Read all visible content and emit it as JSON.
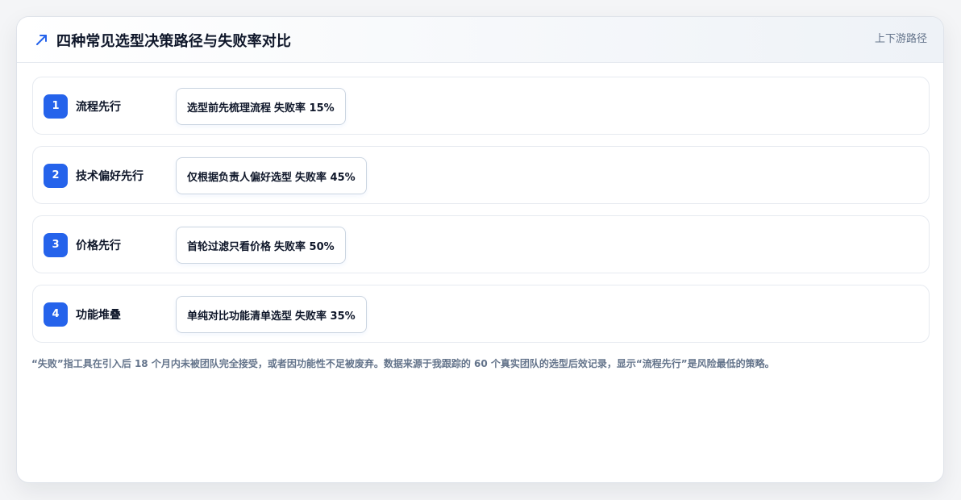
{
  "header": {
    "title": "四种常见选型决策路径与失败率对比",
    "tag": "上下游路径",
    "icon": "trend-arrow-icon"
  },
  "colors": {
    "accent": "#2563eb",
    "text": "#0f172a",
    "muted": "#64748b"
  },
  "paths": [
    {
      "number": "1",
      "name": "流程先行",
      "description": "选型前先梳理流程",
      "rate": "失败率 15%",
      "failure_rate_pct": 15
    },
    {
      "number": "2",
      "name": "技术偏好先行",
      "description": "仅根据负责人偏好选型",
      "rate": "失败率 45%",
      "failure_rate_pct": 45
    },
    {
      "number": "3",
      "name": "价格先行",
      "description": "首轮过滤只看价格",
      "rate": "失败率 50%",
      "failure_rate_pct": 50
    },
    {
      "number": "4",
      "name": "功能堆叠",
      "description": "单纯对比功能清单选型",
      "rate": "失败率 35%",
      "failure_rate_pct": 35
    }
  ],
  "footnote": "“失败”指工具在引入后 18 个月内未被团队完全接受，或者因功能性不足被废弃。数据来源于我跟踪的 60 个真实团队的选型后效记录，显示“流程先行”是风险最低的策略。"
}
